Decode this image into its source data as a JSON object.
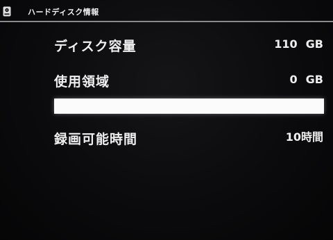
{
  "header": {
    "title": "ハードディスク情報",
    "icon": "hdd-icon"
  },
  "rows": [
    {
      "label": "ディスク容量",
      "value": "110",
      "unit": "GB"
    },
    {
      "label": "使用領域",
      "value": "0",
      "unit": "GB"
    },
    {
      "label": "録画可能時間",
      "value": "10時間"
    }
  ],
  "usage": {
    "used_fraction": 0.0
  },
  "colors": {
    "background": "#0b0b0d",
    "text": "#efefef",
    "bar_remaining": "#fbfbfb"
  }
}
